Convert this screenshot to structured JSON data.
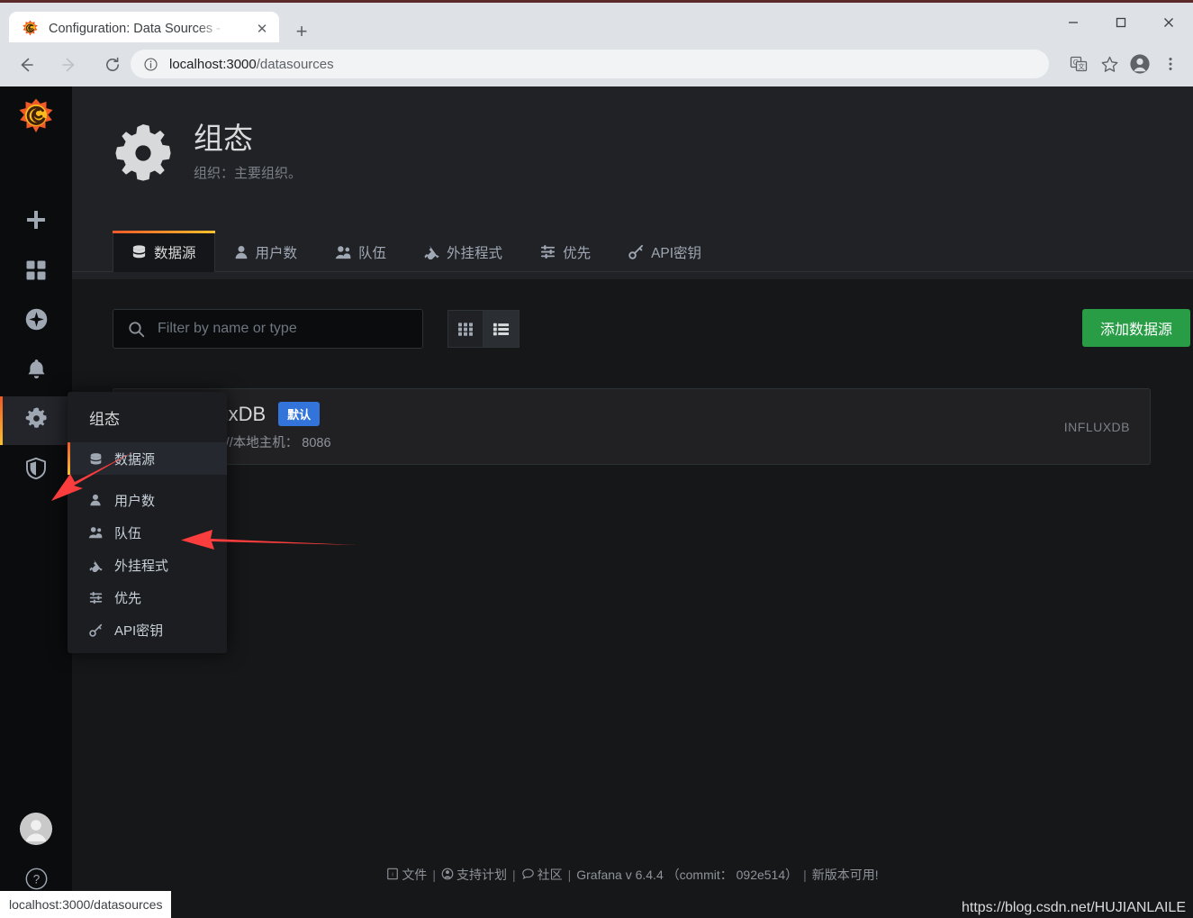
{
  "browser": {
    "tab": {
      "title": "Configuration: Data Sources -",
      "favicon": "grafana-logo-icon",
      "close_icon": "✕"
    },
    "new_tab_icon": "+",
    "window_controls": {
      "minimize": "—",
      "maximize": "□",
      "close": "✕"
    },
    "nav": {
      "back_icon": "←",
      "forward_icon": "→",
      "reload_icon": "↻"
    },
    "omnibox": {
      "info_icon": "info-circle-icon",
      "url_host": "localhost:3000",
      "url_path": "/datasources"
    },
    "toolbar_icons": [
      "translate-icon",
      "bookmark-star-icon",
      "profile-avatar-icon",
      "three-dot-menu-icon"
    ]
  },
  "sidemenu": {
    "brand": "grafana-logo-icon",
    "items": [
      {
        "name": "create",
        "icon": "plus-icon",
        "active": false
      },
      {
        "name": "dashboards",
        "icon": "apps-grid-icon",
        "active": false
      },
      {
        "name": "explore",
        "icon": "compass-icon",
        "active": false
      },
      {
        "name": "alerting",
        "icon": "bell-icon",
        "active": false
      },
      {
        "name": "configuration",
        "icon": "gear-icon",
        "active": true
      },
      {
        "name": "server-admin",
        "icon": "shield-icon",
        "active": false
      }
    ],
    "user_avatar": "user-avatar-icon",
    "help_icon": "question-circle-icon"
  },
  "page": {
    "icon": "gear-icon",
    "title": "组态",
    "subtitle": "组织：主要组织。"
  },
  "tabs": [
    {
      "label": "数据源",
      "icon": "database-icon",
      "active": true
    },
    {
      "label": "用户数",
      "icon": "user-icon",
      "active": false
    },
    {
      "label": "队伍",
      "icon": "users-icon",
      "active": false
    },
    {
      "label": "外挂程式",
      "icon": "plug-icon",
      "active": false
    },
    {
      "label": "优先",
      "icon": "sliders-icon",
      "active": false
    },
    {
      "label": "API密钥",
      "icon": "key-icon",
      "active": false
    }
  ],
  "toolbar": {
    "search_icon": "search-icon",
    "search_placeholder": "Filter by name or type",
    "search_value": "",
    "view_grid_icon": "grid-view-icon",
    "view_list_icon": "list-view-icon",
    "view_active": "list",
    "add_button_label": "添加数据源",
    "add_button_color": "#299c46"
  },
  "datasources": [
    {
      "logo": "influxdb-logo-icon",
      "name": "InfluxDB",
      "badge": "默认",
      "badge_color": "#3274d9",
      "url": "http：//本地主机： 8086",
      "type": "INFLUXDB"
    }
  ],
  "dropdown": {
    "header": "组态",
    "items": [
      {
        "label": "数据源",
        "icon": "database-icon",
        "active": true
      },
      {
        "label": "用户数",
        "icon": "user-icon",
        "active": false
      },
      {
        "label": "队伍",
        "icon": "users-icon",
        "active": false
      },
      {
        "label": "外挂程式",
        "icon": "plug-icon",
        "active": false
      },
      {
        "label": "优先",
        "icon": "sliders-icon",
        "active": false
      },
      {
        "label": "API密钥",
        "icon": "key-icon",
        "active": false
      }
    ]
  },
  "annotations": {
    "arrow_color": "#fc3d3d",
    "arrows": [
      {
        "name": "arrow-to-config-gear"
      },
      {
        "name": "arrow-to-datasources-menu-item"
      }
    ]
  },
  "footer": {
    "docs": "文件",
    "support": "支持计划",
    "community": "社区",
    "version": "Grafana v 6.4.4 （commit： 092e514）",
    "new_version": "新版本可用!"
  },
  "status_bubble": "localhost:3000/datasources",
  "watermark": "https://blog.csdn.net/HUJIANLAILE"
}
